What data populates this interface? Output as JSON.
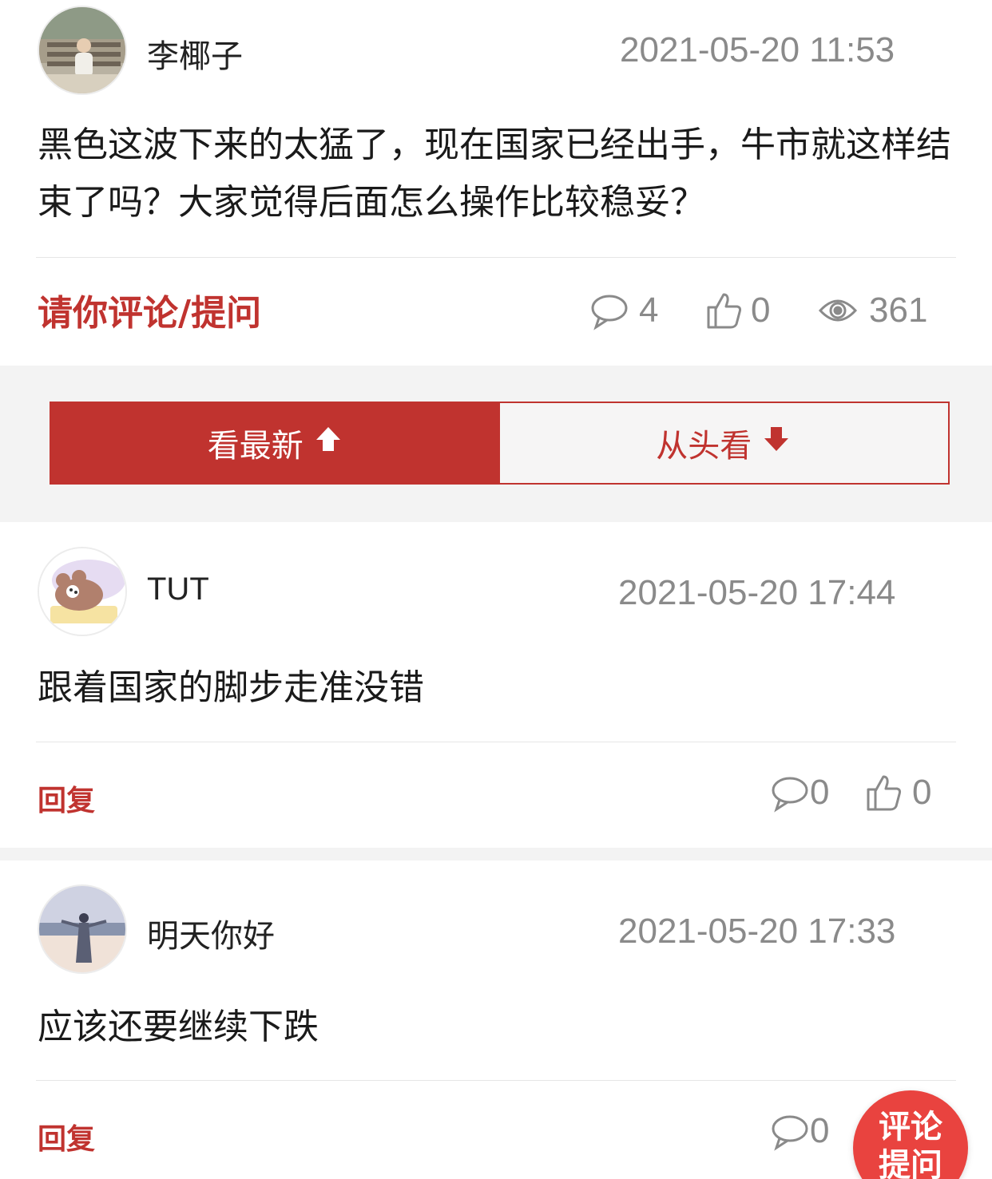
{
  "post": {
    "author": "李椰子",
    "timestamp": "2021-05-20 11:53",
    "content": "黑色这波下来的太猛了，现在国家已经出手，牛市就这样结束了吗？大家觉得后面怎么操作比较稳妥？",
    "ask_label": "请你评论/提问",
    "comment_count": "4",
    "like_count": "0",
    "view_count": "361"
  },
  "sort": {
    "newest_label": "看最新",
    "oldest_label": "从头看"
  },
  "comments": [
    {
      "author": "TUT",
      "timestamp": "2021-05-20 17:44",
      "content": "跟着国家的脚步走准没错",
      "reply_label": "回复",
      "reply_count": "0",
      "like_count": "0"
    },
    {
      "author": "明天你好",
      "timestamp": "2021-05-20 17:33",
      "content": "应该还要继续下跌",
      "reply_label": "回复",
      "reply_count": "0"
    }
  ],
  "fab": {
    "line1": "评论",
    "line2": "提问"
  },
  "colors": {
    "accent": "#c0332f",
    "fab": "#e9433f",
    "muted": "#8a8a8a",
    "band": "#f3f3f3"
  },
  "icons": [
    "comment-bubble-icon",
    "thumbs-up-icon",
    "eye-icon",
    "arrow-up-icon",
    "arrow-down-icon"
  ]
}
